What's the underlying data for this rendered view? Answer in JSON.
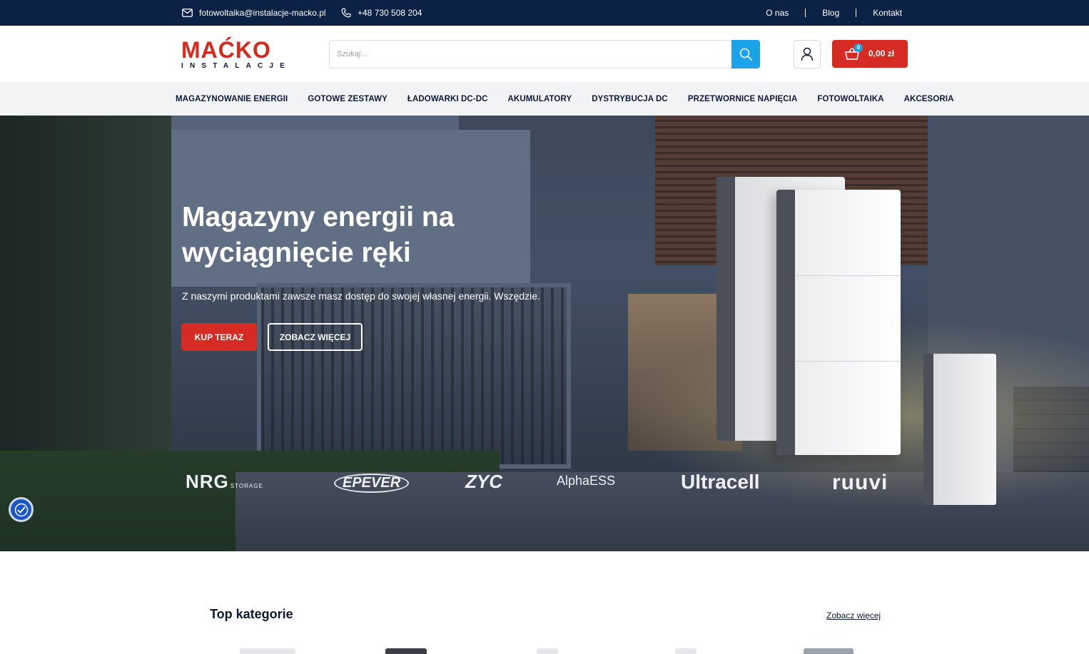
{
  "topbar": {
    "email": "fotowoltaika@instalacje-macko.pl",
    "phone": "+48 730 508 204",
    "links": [
      "O nas",
      "Blog",
      "Kontakt"
    ]
  },
  "header": {
    "logo_main": "MAĆKO",
    "logo_sub": "INSTALACJE",
    "search_placeholder": "Szukaj...",
    "cart_count": "0",
    "cart_total": "0,00 zł"
  },
  "nav": {
    "items": [
      "MAGAZYNOWANIE ENERGII",
      "GOTOWE ZESTAWY",
      "ŁADOWARKI DC-DC",
      "AKUMULATORY",
      "DYSTRYBUCJA DC",
      "PRZETWORNICE NAPIĘCIA",
      "FOTOWOLTAIKA",
      "AKCESORIA"
    ]
  },
  "hero": {
    "title": "Magazyny energii na wyciągnięcie ręki",
    "subtitle": "Z naszymi produktami zawsze masz dostęp do swojej własnej energii. Wszędzie.",
    "primary_button": "KUP TERAZ",
    "secondary_button": "ZOBACZ WIĘCEJ",
    "brands": [
      "NRG",
      "STORAGE",
      "EPEVER",
      "ZYC",
      "AlphaESS",
      "Ultracell",
      "ruuvi"
    ]
  },
  "categories": {
    "title": "Top kategorie",
    "more": "Zobacz więcej"
  },
  "colors": {
    "topbar": "#0c2146",
    "accent_red": "#d62b22",
    "accent_blue": "#1aa3e8",
    "nav_bg": "#f2f3f5"
  }
}
